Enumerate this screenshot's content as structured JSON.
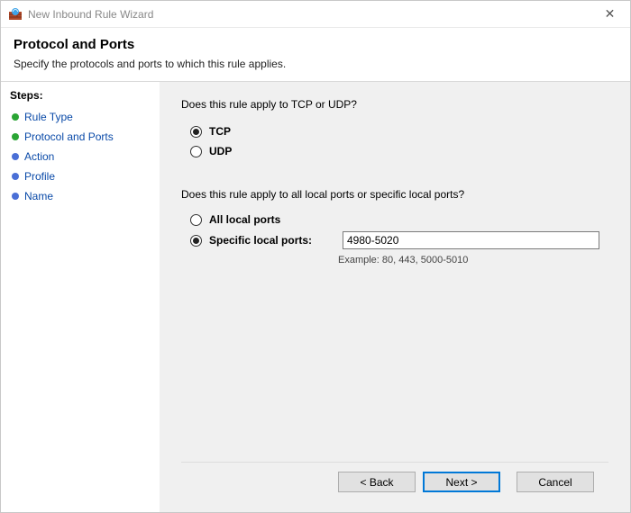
{
  "window": {
    "title": "New Inbound Rule Wizard",
    "close_glyph": "✕"
  },
  "header": {
    "title": "Protocol and Ports",
    "subtitle": "Specify the protocols and ports to which this rule applies."
  },
  "sidebar": {
    "title": "Steps:",
    "items": [
      {
        "label": "Rule Type",
        "state": "done"
      },
      {
        "label": "Protocol and Ports",
        "state": "done"
      },
      {
        "label": "Action",
        "state": "pending"
      },
      {
        "label": "Profile",
        "state": "pending"
      },
      {
        "label": "Name",
        "state": "pending"
      }
    ]
  },
  "content": {
    "protocol_prompt": "Does this rule apply to TCP or UDP?",
    "tcp_label": "TCP",
    "udp_label": "UDP",
    "protocol_selected": "TCP",
    "ports_prompt": "Does this rule apply to all local ports or specific local ports?",
    "all_ports_label": "All local ports",
    "specific_ports_label": "Specific local ports:",
    "ports_selected": "specific",
    "ports_value": "4980-5020",
    "ports_example": "Example: 80, 443, 5000-5010"
  },
  "footer": {
    "back": "< Back",
    "next": "Next >",
    "cancel": "Cancel"
  }
}
